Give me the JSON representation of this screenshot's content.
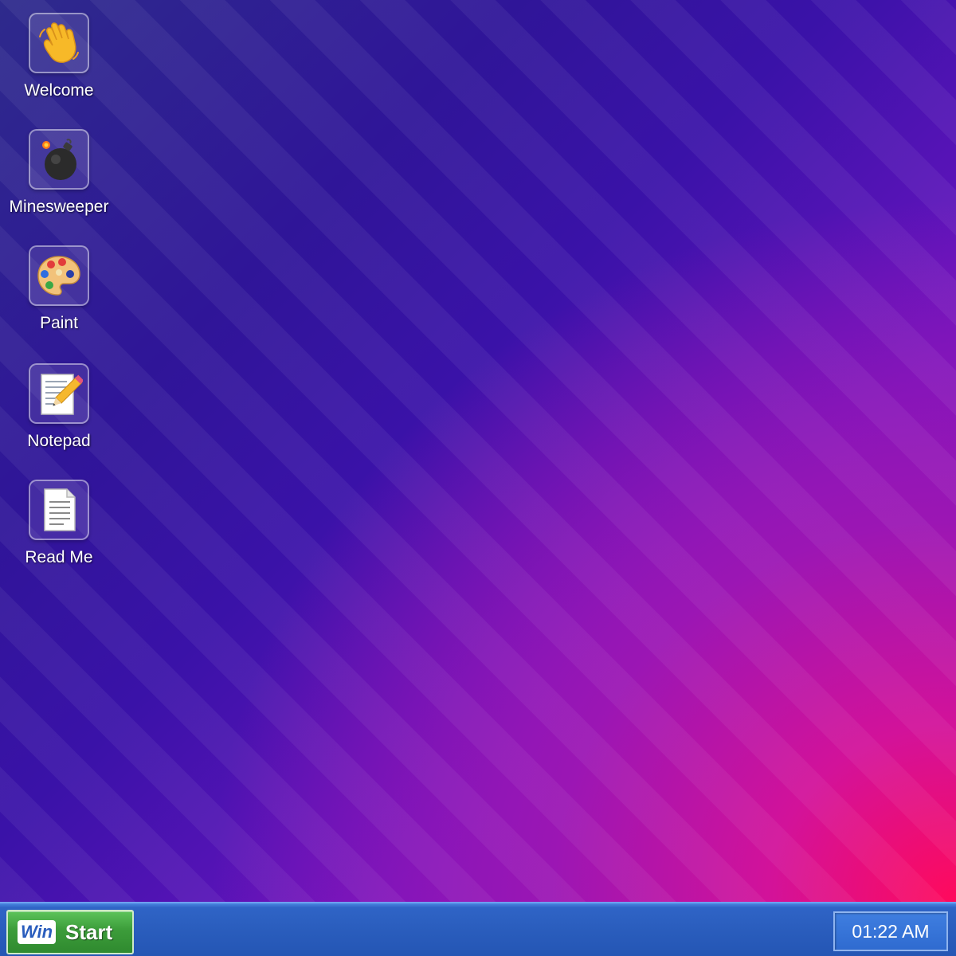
{
  "desktop": {
    "icons": [
      {
        "label": "Welcome",
        "icon": "waving-hand-icon"
      },
      {
        "label": "Minesweeper",
        "icon": "bomb-icon"
      },
      {
        "label": "Paint",
        "icon": "palette-icon"
      },
      {
        "label": "Notepad",
        "icon": "memo-pencil-icon"
      },
      {
        "label": "Read Me",
        "icon": "document-icon"
      }
    ]
  },
  "taskbar": {
    "start_badge": "Win",
    "start_label": "Start",
    "clock": "01:22 AM"
  },
  "colors": {
    "taskbar": "#2a5dbd",
    "start_button": "#3c9c3a",
    "wallpaper_start": "#2e2a8c",
    "wallpaper_end": "#ff0a5c"
  }
}
